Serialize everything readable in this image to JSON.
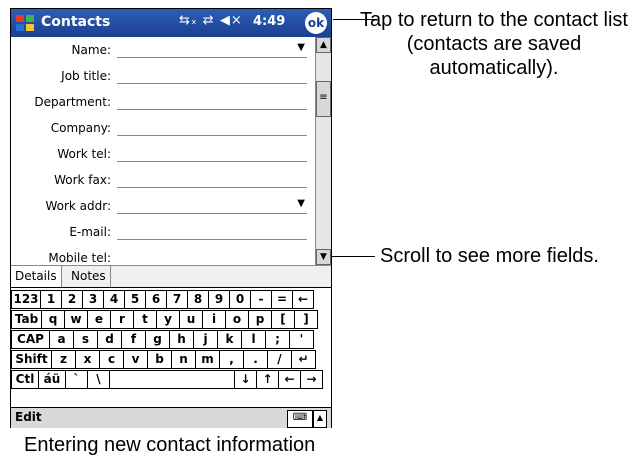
{
  "titlebar": {
    "app_title": "Contacts",
    "status_icons": "⇆ₓ ⇄ ◀×",
    "time": "4:49",
    "ok_label": "ok"
  },
  "form": {
    "fields": [
      {
        "label": "Name:",
        "dropdown": true
      },
      {
        "label": "Job title:",
        "dropdown": false
      },
      {
        "label": "Department:",
        "dropdown": false
      },
      {
        "label": "Company:",
        "dropdown": false
      },
      {
        "label": "Work tel:",
        "dropdown": false
      },
      {
        "label": "Work fax:",
        "dropdown": false
      },
      {
        "label": "Work addr:",
        "dropdown": true
      },
      {
        "label": "E-mail:",
        "dropdown": false
      },
      {
        "label": "Mobile tel:",
        "dropdown": false
      }
    ],
    "dropdown_glyph": "▼"
  },
  "scrollbar": {
    "up": "▲",
    "down": "▼",
    "thumb": "≡"
  },
  "tabs": {
    "details": "Details",
    "notes": "Notes"
  },
  "keyboard": {
    "rows": [
      [
        "123",
        "1",
        "2",
        "3",
        "4",
        "5",
        "6",
        "7",
        "8",
        "9",
        "0",
        "-",
        "=",
        "←"
      ],
      [
        "Tab",
        "q",
        "w",
        "e",
        "r",
        "t",
        "y",
        "u",
        "i",
        "o",
        "p",
        "[",
        "]"
      ],
      [
        "CAP",
        "a",
        "s",
        "d",
        "f",
        "g",
        "h",
        "j",
        "k",
        "l",
        ";",
        "'"
      ],
      [
        "Shift",
        "z",
        "x",
        "c",
        "v",
        "b",
        "n",
        "m",
        ",",
        ".",
        "/",
        "↵"
      ],
      [
        "Ctl",
        "áü",
        "`",
        "\\",
        " ",
        "↓",
        "↑",
        "←",
        "→"
      ]
    ]
  },
  "menubar": {
    "edit": "Edit",
    "keyboard_icon": "⌨",
    "arrow": "▲"
  },
  "callouts": {
    "ok_note": "Tap to return to the contact list (contacts are saved automatically).",
    "scroll_note": "Scroll to see more fields."
  },
  "caption": "Entering new contact information",
  "colors": {
    "titlebar": "#2c5fb8",
    "accent": "#1b3f8f"
  }
}
